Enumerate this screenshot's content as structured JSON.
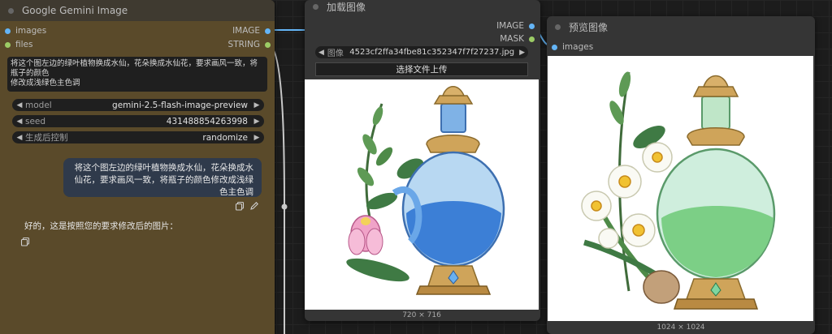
{
  "gemini_node": {
    "title": "Google Gemini Image",
    "inputs": [
      {
        "label": "images",
        "color": "#64b5f6"
      },
      {
        "label": "files",
        "color": "#9ccc65"
      }
    ],
    "outputs": [
      {
        "label": "IMAGE",
        "color": "#64b5f6"
      },
      {
        "label": "STRING",
        "color": "#9ccc65"
      }
    ],
    "prompt_line1": "将这个图左边的绿叶植物换成水仙，花朵换成水仙花，要求画风一致，将瓶子的颜色",
    "prompt_line2": "修改成浅绿色主色调",
    "widgets": [
      {
        "label": "model",
        "value": "gemini-2.5-flash-image-preview"
      },
      {
        "label": "seed",
        "value": "431488854263998"
      },
      {
        "label": "生成后控制",
        "value": "randomize"
      }
    ],
    "user_message_line1": "将这个图左边的绿叶植物换成水仙，花朵换成水",
    "user_message_line2": "仙花，要求画风一致，将瓶子的颜色修改成浅绿",
    "user_message_line3": "色主色调",
    "assistant_reply": "好的，这是按照您的要求修改后的图片："
  },
  "load_node": {
    "title": "加载图像",
    "outputs": [
      {
        "label": "IMAGE",
        "color": "#64b5f6"
      },
      {
        "label": "MASK",
        "color": "#9ccc65"
      }
    ],
    "file_label": "图像",
    "file_value": "4523cf2ffa34fbe81c352347f7f27237.jpg",
    "upload_label": "选择文件上传",
    "image_size": "720 × 716"
  },
  "preview_node": {
    "title": "预览图像",
    "input_label": "images",
    "image_size": "1024 × 1024"
  },
  "icons": {
    "copy": "copy-icon",
    "edit": "pencil-icon"
  },
  "colors": {
    "image_wire": "#64b5f6",
    "string_wire": "#b0b0b0",
    "gemini_body": "#5a4a2a"
  }
}
